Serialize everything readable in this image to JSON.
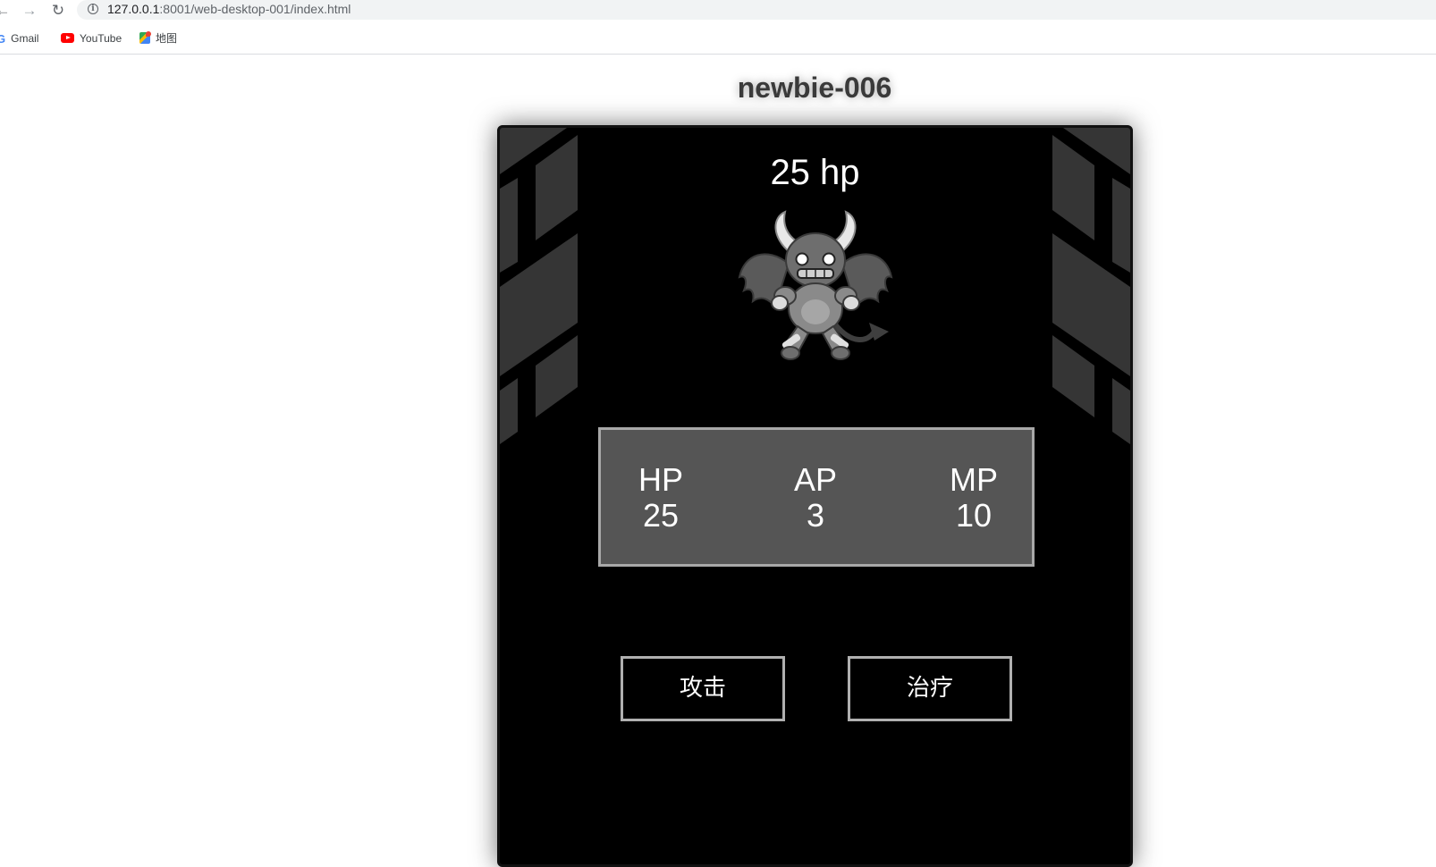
{
  "browser": {
    "url_host": "127.0.0.1",
    "url_rest": ":8001/web-desktop-001/index.html",
    "bookmarks": [
      {
        "label": "Gmail",
        "icon": "google-icon"
      },
      {
        "label": "YouTube",
        "icon": "youtube-icon"
      },
      {
        "label": "地图",
        "icon": "maps-icon"
      }
    ]
  },
  "page": {
    "title": "newbie-006"
  },
  "enemy": {
    "hp_text": "25 hp",
    "sprite": "winged-horned-demon-sprite"
  },
  "stats": {
    "hp_label": "HP",
    "hp_value": "25",
    "ap_label": "AP",
    "ap_value": "3",
    "mp_label": "MP",
    "mp_value": "10"
  },
  "actions": {
    "attack_label": "攻击",
    "heal_label": "治疗"
  },
  "colors": {
    "panel_bg": "#000000",
    "wall": "#353535",
    "stats_bg": "#555555",
    "stats_border": "#a8a8a8",
    "button_border": "#b0b0b0",
    "title": "#3a3a3a"
  }
}
